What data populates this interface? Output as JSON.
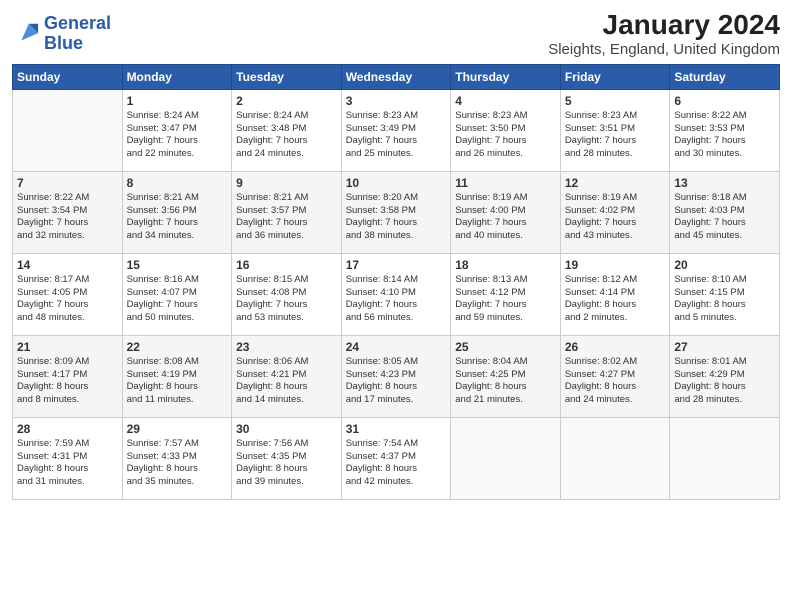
{
  "header": {
    "title": "January 2024",
    "subtitle": "Sleights, England, United Kingdom",
    "logo_line1": "General",
    "logo_line2": "Blue"
  },
  "days_of_week": [
    "Sunday",
    "Monday",
    "Tuesday",
    "Wednesday",
    "Thursday",
    "Friday",
    "Saturday"
  ],
  "weeks": [
    [
      {
        "day": "",
        "info": ""
      },
      {
        "day": "1",
        "info": "Sunrise: 8:24 AM\nSunset: 3:47 PM\nDaylight: 7 hours\nand 22 minutes."
      },
      {
        "day": "2",
        "info": "Sunrise: 8:24 AM\nSunset: 3:48 PM\nDaylight: 7 hours\nand 24 minutes."
      },
      {
        "day": "3",
        "info": "Sunrise: 8:23 AM\nSunset: 3:49 PM\nDaylight: 7 hours\nand 25 minutes."
      },
      {
        "day": "4",
        "info": "Sunrise: 8:23 AM\nSunset: 3:50 PM\nDaylight: 7 hours\nand 26 minutes."
      },
      {
        "day": "5",
        "info": "Sunrise: 8:23 AM\nSunset: 3:51 PM\nDaylight: 7 hours\nand 28 minutes."
      },
      {
        "day": "6",
        "info": "Sunrise: 8:22 AM\nSunset: 3:53 PM\nDaylight: 7 hours\nand 30 minutes."
      }
    ],
    [
      {
        "day": "7",
        "info": "Sunrise: 8:22 AM\nSunset: 3:54 PM\nDaylight: 7 hours\nand 32 minutes."
      },
      {
        "day": "8",
        "info": "Sunrise: 8:21 AM\nSunset: 3:56 PM\nDaylight: 7 hours\nand 34 minutes."
      },
      {
        "day": "9",
        "info": "Sunrise: 8:21 AM\nSunset: 3:57 PM\nDaylight: 7 hours\nand 36 minutes."
      },
      {
        "day": "10",
        "info": "Sunrise: 8:20 AM\nSunset: 3:58 PM\nDaylight: 7 hours\nand 38 minutes."
      },
      {
        "day": "11",
        "info": "Sunrise: 8:19 AM\nSunset: 4:00 PM\nDaylight: 7 hours\nand 40 minutes."
      },
      {
        "day": "12",
        "info": "Sunrise: 8:19 AM\nSunset: 4:02 PM\nDaylight: 7 hours\nand 43 minutes."
      },
      {
        "day": "13",
        "info": "Sunrise: 8:18 AM\nSunset: 4:03 PM\nDaylight: 7 hours\nand 45 minutes."
      }
    ],
    [
      {
        "day": "14",
        "info": "Sunrise: 8:17 AM\nSunset: 4:05 PM\nDaylight: 7 hours\nand 48 minutes."
      },
      {
        "day": "15",
        "info": "Sunrise: 8:16 AM\nSunset: 4:07 PM\nDaylight: 7 hours\nand 50 minutes."
      },
      {
        "day": "16",
        "info": "Sunrise: 8:15 AM\nSunset: 4:08 PM\nDaylight: 7 hours\nand 53 minutes."
      },
      {
        "day": "17",
        "info": "Sunrise: 8:14 AM\nSunset: 4:10 PM\nDaylight: 7 hours\nand 56 minutes."
      },
      {
        "day": "18",
        "info": "Sunrise: 8:13 AM\nSunset: 4:12 PM\nDaylight: 7 hours\nand 59 minutes."
      },
      {
        "day": "19",
        "info": "Sunrise: 8:12 AM\nSunset: 4:14 PM\nDaylight: 8 hours\nand 2 minutes."
      },
      {
        "day": "20",
        "info": "Sunrise: 8:10 AM\nSunset: 4:15 PM\nDaylight: 8 hours\nand 5 minutes."
      }
    ],
    [
      {
        "day": "21",
        "info": "Sunrise: 8:09 AM\nSunset: 4:17 PM\nDaylight: 8 hours\nand 8 minutes."
      },
      {
        "day": "22",
        "info": "Sunrise: 8:08 AM\nSunset: 4:19 PM\nDaylight: 8 hours\nand 11 minutes."
      },
      {
        "day": "23",
        "info": "Sunrise: 8:06 AM\nSunset: 4:21 PM\nDaylight: 8 hours\nand 14 minutes."
      },
      {
        "day": "24",
        "info": "Sunrise: 8:05 AM\nSunset: 4:23 PM\nDaylight: 8 hours\nand 17 minutes."
      },
      {
        "day": "25",
        "info": "Sunrise: 8:04 AM\nSunset: 4:25 PM\nDaylight: 8 hours\nand 21 minutes."
      },
      {
        "day": "26",
        "info": "Sunrise: 8:02 AM\nSunset: 4:27 PM\nDaylight: 8 hours\nand 24 minutes."
      },
      {
        "day": "27",
        "info": "Sunrise: 8:01 AM\nSunset: 4:29 PM\nDaylight: 8 hours\nand 28 minutes."
      }
    ],
    [
      {
        "day": "28",
        "info": "Sunrise: 7:59 AM\nSunset: 4:31 PM\nDaylight: 8 hours\nand 31 minutes."
      },
      {
        "day": "29",
        "info": "Sunrise: 7:57 AM\nSunset: 4:33 PM\nDaylight: 8 hours\nand 35 minutes."
      },
      {
        "day": "30",
        "info": "Sunrise: 7:56 AM\nSunset: 4:35 PM\nDaylight: 8 hours\nand 39 minutes."
      },
      {
        "day": "31",
        "info": "Sunrise: 7:54 AM\nSunset: 4:37 PM\nDaylight: 8 hours\nand 42 minutes."
      },
      {
        "day": "",
        "info": ""
      },
      {
        "day": "",
        "info": ""
      },
      {
        "day": "",
        "info": ""
      }
    ]
  ]
}
